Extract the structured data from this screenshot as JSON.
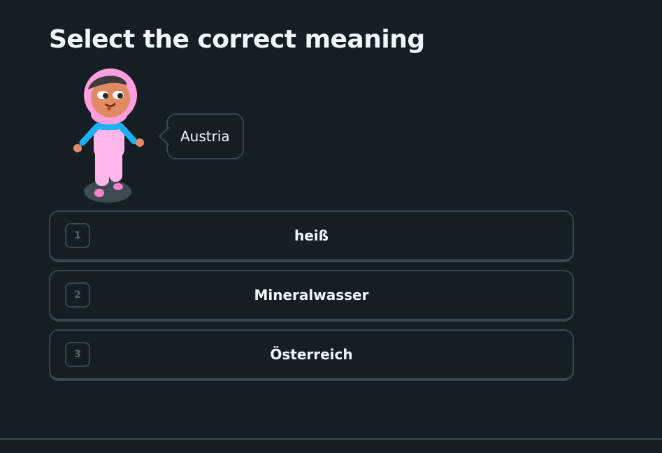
{
  "exercise": {
    "title": "Select the correct meaning",
    "prompt_word": "Austria",
    "character_icon": "hijab-girl-character-icon"
  },
  "choices": [
    {
      "key": "1",
      "label": "heiß"
    },
    {
      "key": "2",
      "label": "Mineralwasser"
    },
    {
      "key": "3",
      "label": "Österreich"
    }
  ],
  "colors": {
    "background": "#151e24",
    "border": "#37464f",
    "text": "#f1f7fb",
    "key_text": "#52656d",
    "character_hijab": "#ff9fe0",
    "character_shirt": "#1cb0f6",
    "character_skin": "#e08a63"
  }
}
